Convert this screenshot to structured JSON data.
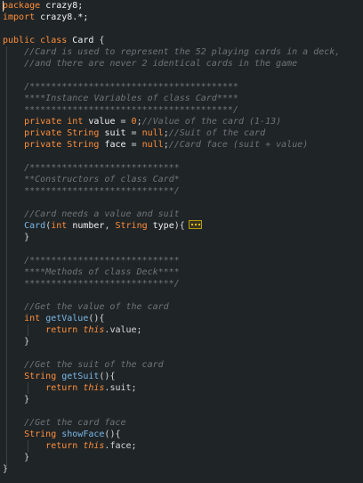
{
  "code": {
    "l1_pkg": "package",
    "l1_name": "crazy8;",
    "l2_imp": "import",
    "l2_name": "crazy8.*;",
    "l4_pub": "public",
    "l4_class": "class",
    "l4_name": "Card",
    "l4_brace": " {",
    "l5_comment": "//Card is used to represent the 52 playing cards in a deck,",
    "l6_comment": "//and there are never 2 identical cards in the game",
    "l8_comment": "/***************************************",
    "l9_comment": "****Instance Variables of class Card****",
    "l10_comment": "***************************************/",
    "l11_priv": "private",
    "l11_type": "int",
    "l11_var": "value",
    "l11_eq": " = ",
    "l11_val": "0",
    "l11_semi": ";",
    "l11_comment": "//Value of the card (1-13)",
    "l12_priv": "private",
    "l12_type": "String",
    "l12_var": "suit",
    "l12_eq": " = ",
    "l12_val": "null",
    "l12_semi": ";",
    "l12_comment": "//Suit of the card",
    "l13_priv": "private",
    "l13_type": "String",
    "l13_var": "face",
    "l13_eq": " = ",
    "l13_val": "null",
    "l13_semi": ";",
    "l13_comment": "//Card face (suit + value)",
    "l15_comment": "/****************************",
    "l16_comment": "**Constructors of class Card*",
    "l17_comment": "****************************/",
    "l19_comment": "//Card needs a value and suit",
    "l20_name": "Card",
    "l20_open": "(",
    "l20_t1": "int",
    "l20_p1": "number",
    "l20_comma": ", ",
    "l20_t2": "String",
    "l20_p2": "type",
    "l20_close": "){",
    "l21_brace": "}",
    "l23_comment": "/****************************",
    "l24_comment": "****Methods of class Deck****",
    "l25_comment": "****************************/",
    "l27_comment": "//Get the value of the card",
    "l28_type": "int",
    "l28_name": "getValue",
    "l28_rest": "(){",
    "l29_ret": "return",
    "l29_this": "this",
    "l29_rest": ".value;",
    "l30_brace": "}",
    "l32_comment": "//Get the suit of the card",
    "l33_type": "String",
    "l33_name": "getSuit",
    "l33_rest": "(){",
    "l34_ret": "return",
    "l34_this": "this",
    "l34_rest": ".suit;",
    "l35_brace": "}",
    "l37_comment": "//Get the card face",
    "l38_type": "String",
    "l38_name": "showFace",
    "l38_rest": "(){",
    "l39_ret": "return",
    "l39_this": "this",
    "l39_rest": ".face;",
    "l40_brace": "}",
    "l42_brace": "}"
  },
  "colors": {
    "background": "#1f2427",
    "keyword": "#ff8f3a",
    "function": "#7ab8e6",
    "comment": "#70747a",
    "text": "#d7d7d7",
    "fold_marker": "#f2c400"
  }
}
